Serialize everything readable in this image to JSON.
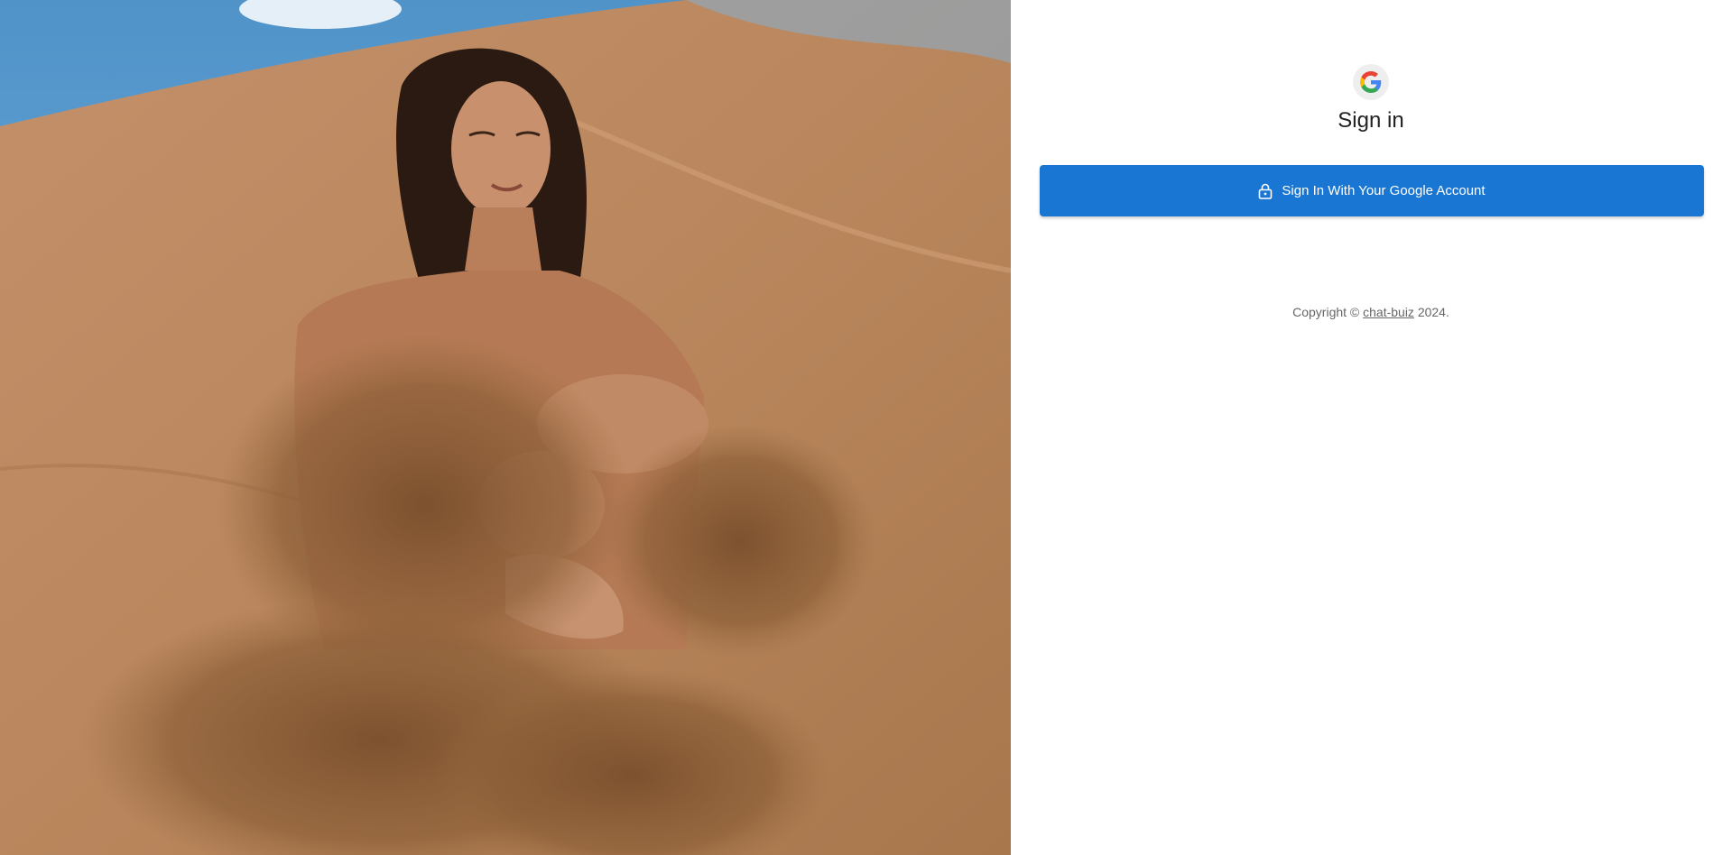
{
  "hero": {
    "image": "woman-in-sand-desert-photo",
    "colors": {
      "sky": "#5aa0d0",
      "sand": "#c08a5c",
      "sand_dark": "#8a5a34"
    }
  },
  "login": {
    "logo": "google-g-logo",
    "title": "Sign in",
    "button_icon": "lock-icon",
    "button_label": "Sign In With Your Google Account",
    "button_color": "#1976d2"
  },
  "footer": {
    "prefix": "Copyright © ",
    "link_text": "chat-buiz",
    "suffix": " 2024."
  }
}
